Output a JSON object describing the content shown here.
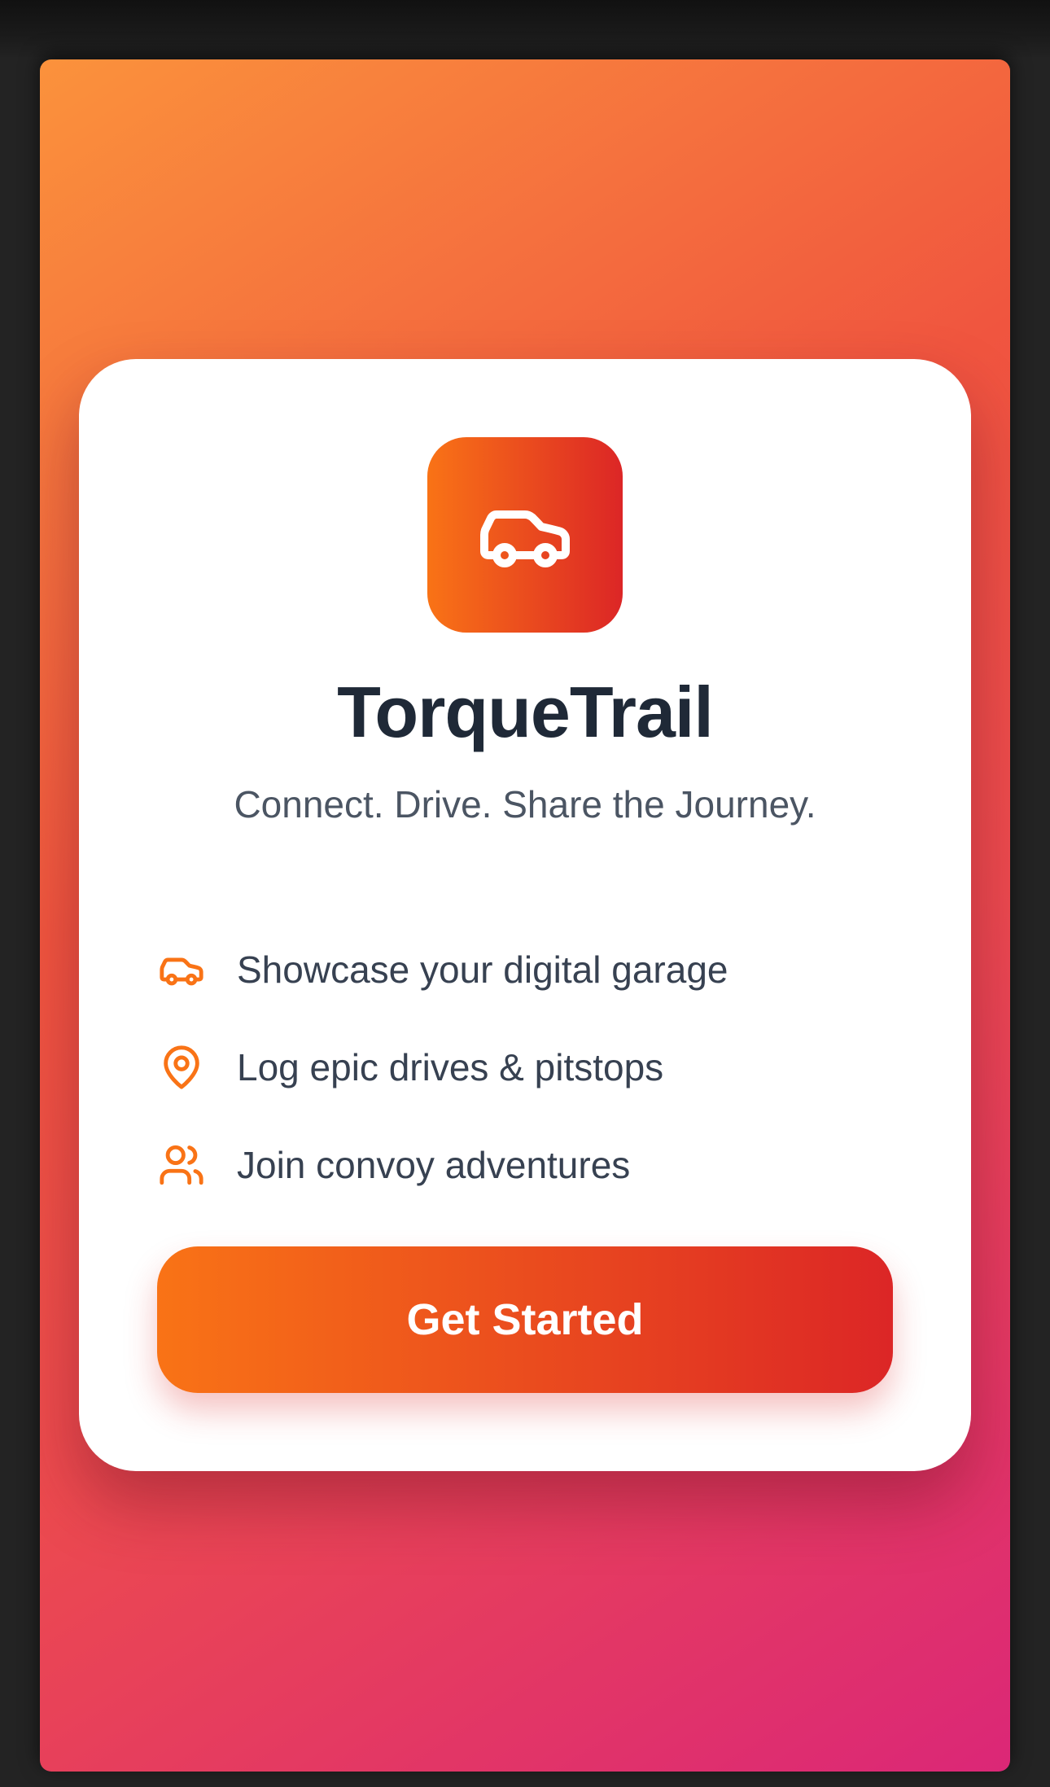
{
  "app": {
    "name": "TorqueTrail",
    "tagline": "Connect. Drive. Share the Journey.",
    "logo_icon": "car-icon"
  },
  "features": [
    {
      "icon": "car-icon",
      "label": "Showcase your digital garage"
    },
    {
      "icon": "map-pin-icon",
      "label": "Log epic drives & pitstops"
    },
    {
      "icon": "users-icon",
      "label": "Join convoy adventures"
    }
  ],
  "cta": {
    "label": "Get Started"
  },
  "colors": {
    "accent_start": "#f97316",
    "accent_end": "#dc2626",
    "background_start": "#fb923c",
    "background_end": "#db2777",
    "title": "#1f2937",
    "text": "#374151"
  }
}
